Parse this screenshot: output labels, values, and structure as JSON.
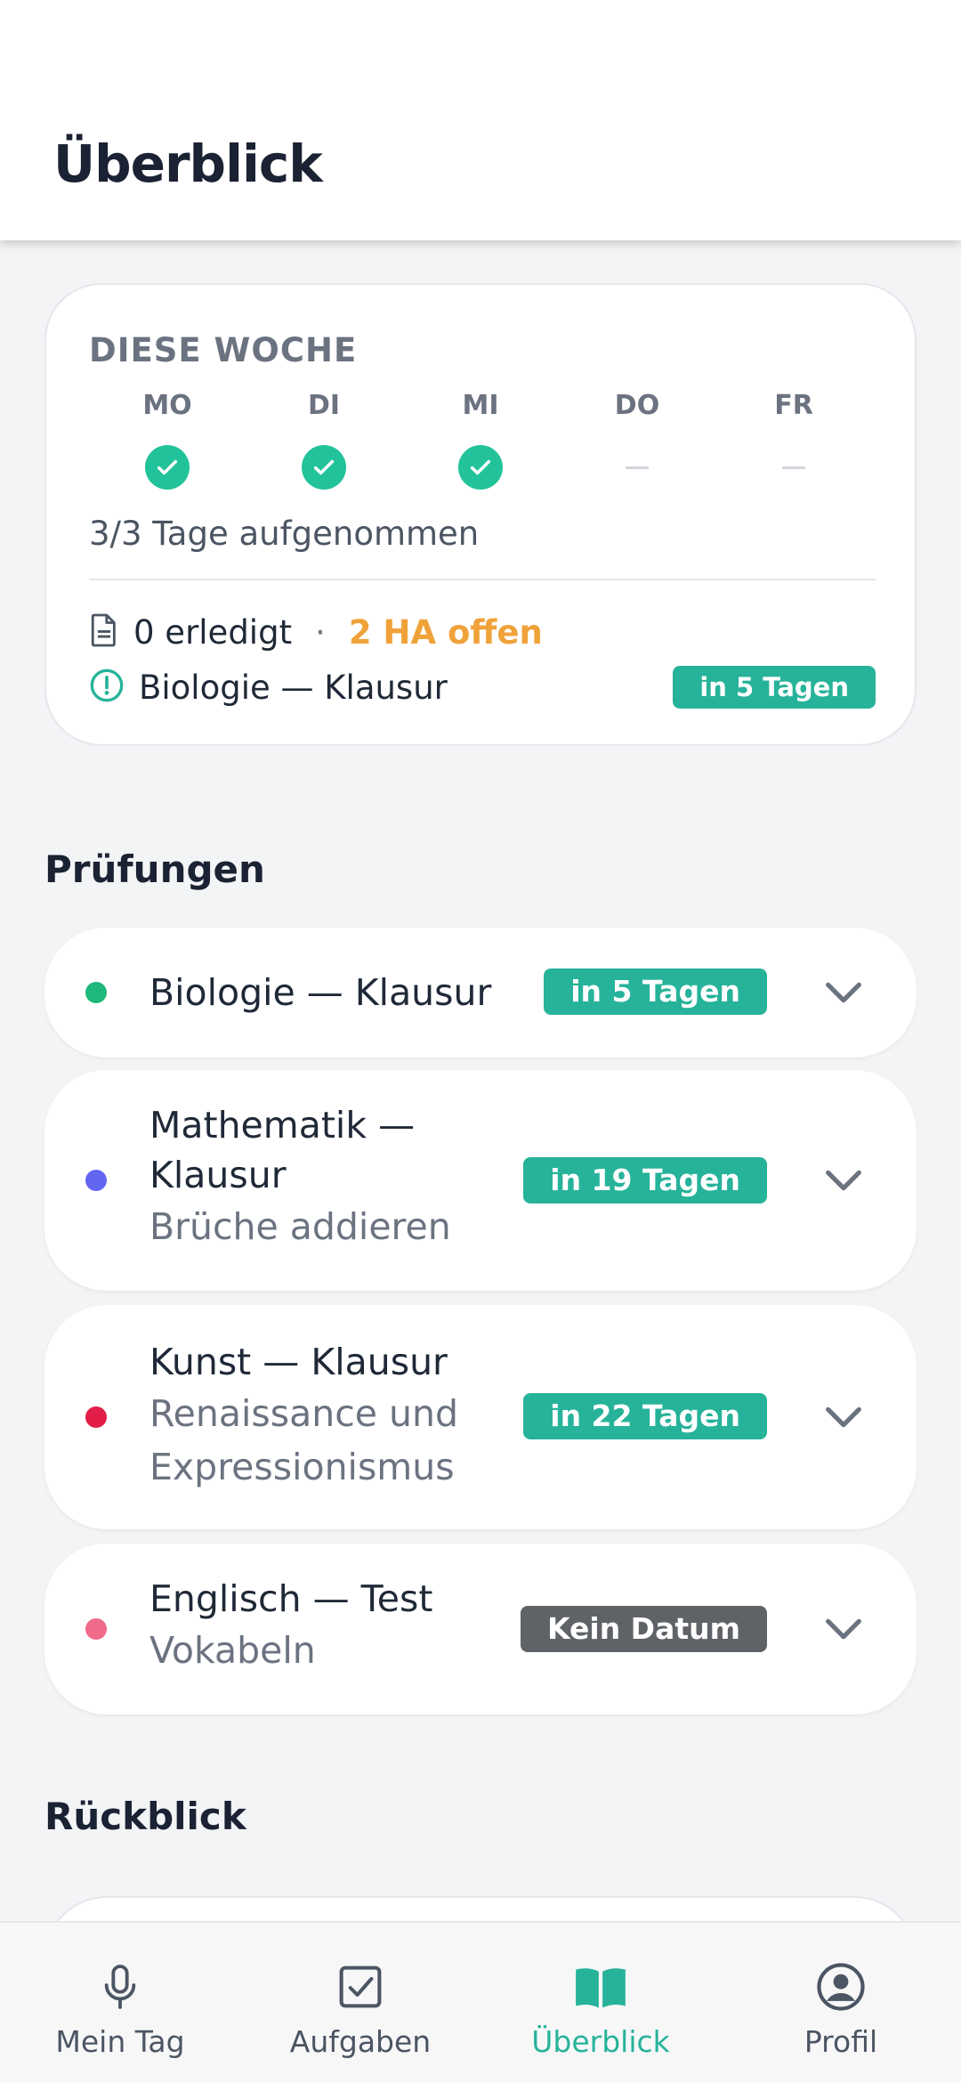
{
  "header": {
    "title": "Überblick"
  },
  "week": {
    "title": "DIESE WOCHE",
    "days": [
      {
        "label": "MO",
        "done": true
      },
      {
        "label": "DI",
        "done": true
      },
      {
        "label": "MI",
        "done": true
      },
      {
        "label": "DO",
        "done": false
      },
      {
        "label": "FR",
        "done": false
      }
    ],
    "summary": "3/3 Tage aufgenommen",
    "done_text": "0 erledigt",
    "separator": "·",
    "open_text": "2 HA offen",
    "next_exam": "Biologie — Klausur",
    "next_exam_badge": "in 5 Tagen"
  },
  "exams": {
    "title": "Prüfungen",
    "items": [
      {
        "title": "Biologie — Klausur",
        "subtitle": "",
        "badge": "in 5 Tagen",
        "color": "#1db87a"
      },
      {
        "title": "Mathematik — Klausur",
        "subtitle": "Brüche addieren",
        "badge": "in 19 Tagen",
        "color": "#6366f1"
      },
      {
        "title": "Kunst — Klausur",
        "subtitle": "Renaissance und Expressionismus",
        "badge": "in 22 Tagen",
        "color": "#e11d48"
      },
      {
        "title": "Englisch — Test",
        "subtitle": "Vokabeln",
        "badge": "Kein Datum",
        "color": "#f06a8a"
      }
    ]
  },
  "review": {
    "title": "Rückblick"
  },
  "nav": {
    "items": [
      {
        "label": "Mein Tag",
        "icon": "microphone-icon"
      },
      {
        "label": "Aufgaben",
        "icon": "checkbox-icon"
      },
      {
        "label": "Überblick",
        "icon": "book-icon"
      },
      {
        "label": "Profil",
        "icon": "profile-icon"
      }
    ],
    "active": "Überblick"
  },
  "colors": {
    "accent": "#26b39a",
    "warning": "#f0a23a",
    "neutral_badge": "#5f6368"
  }
}
